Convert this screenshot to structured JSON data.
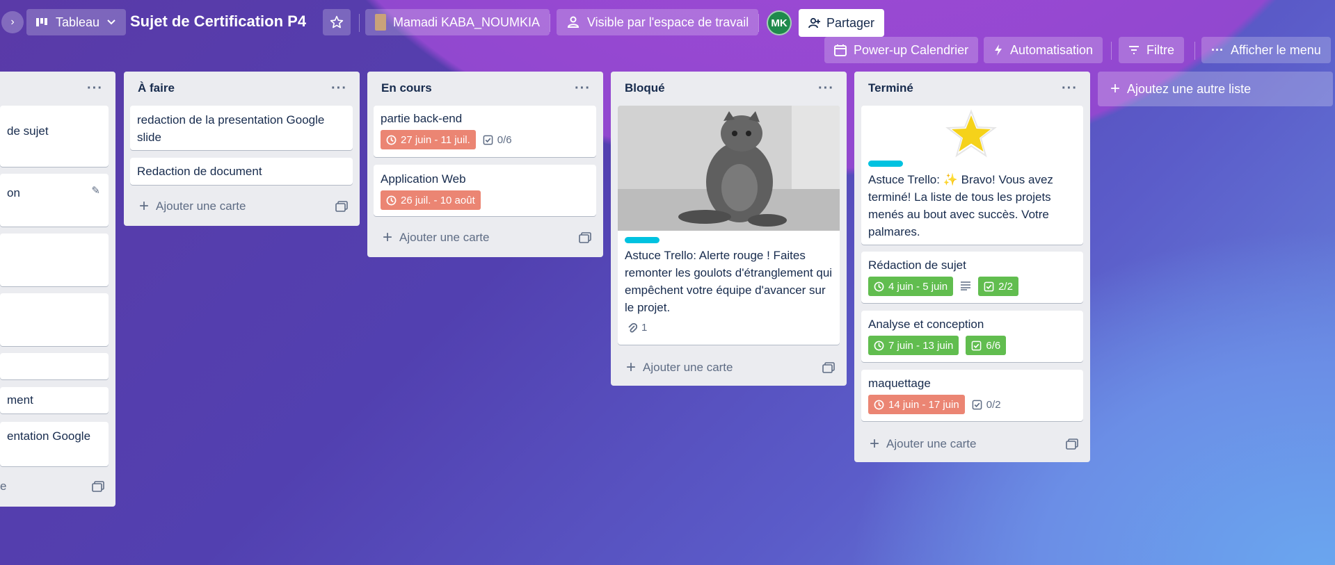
{
  "header": {
    "view_label": "Tableau",
    "board_title": "Sujet de Certification P4",
    "member_name": "Mamadi KABA_NOUMKIA",
    "visibility_label": "Visible par l'espace de travail",
    "avatar_initials": "MK",
    "share_label": "Partager"
  },
  "toolbar": {
    "powerup_label": "Power-up Calendrier",
    "automation_label": "Automatisation",
    "filter_label": "Filtre",
    "menu_label": "Afficher le menu"
  },
  "lists": {
    "partial": {
      "cards": [
        "de sujet",
        "on",
        "",
        "",
        "",
        "ment",
        "entation Google"
      ],
      "add_label": "e"
    },
    "todo": {
      "title": "À faire",
      "cards": [
        {
          "title": "redaction de la presentation Google slide"
        },
        {
          "title": "Redaction de document"
        }
      ],
      "add_label": "Ajouter une carte"
    },
    "in_progress": {
      "title": "En cours",
      "cards": [
        {
          "title": "partie back-end",
          "due": "27 juin - 11 juil.",
          "checklist": "0/6"
        },
        {
          "title": "Application Web",
          "due": "26 juil. - 10 août"
        }
      ],
      "add_label": "Ajouter une carte"
    },
    "blocked": {
      "title": "Bloqué",
      "cards": [
        {
          "title": "Astuce Trello: Alerte rouge ! Faites remonter les goulots d'étranglement qui empêchent votre équipe d'avancer sur le projet.",
          "attachments": "1"
        }
      ],
      "add_label": "Ajouter une carte"
    },
    "done": {
      "title": "Terminé",
      "cards": [
        {
          "title": "Astuce Trello: ✨ Bravo! Vous avez terminé! La liste de tous les projets menés au bout avec succès. Votre palmares."
        },
        {
          "title": "Rédaction de sujet",
          "due": "4 juin - 5 juin",
          "checklist": "2/2"
        },
        {
          "title": "Analyse et conception",
          "due": "7 juin - 13 juin",
          "checklist": "6/6"
        },
        {
          "title": "maquettage",
          "due": "14 juin - 17 juin",
          "checklist": "0/2"
        }
      ],
      "add_label": "Ajouter une carte"
    }
  },
  "add_list_label": "Ajoutez une autre liste",
  "colors": {
    "due_overdue": "#eb8573",
    "due_complete": "#61bd4f",
    "label_cyan": "#00c2e0",
    "list_bg": "#ebecf0"
  }
}
